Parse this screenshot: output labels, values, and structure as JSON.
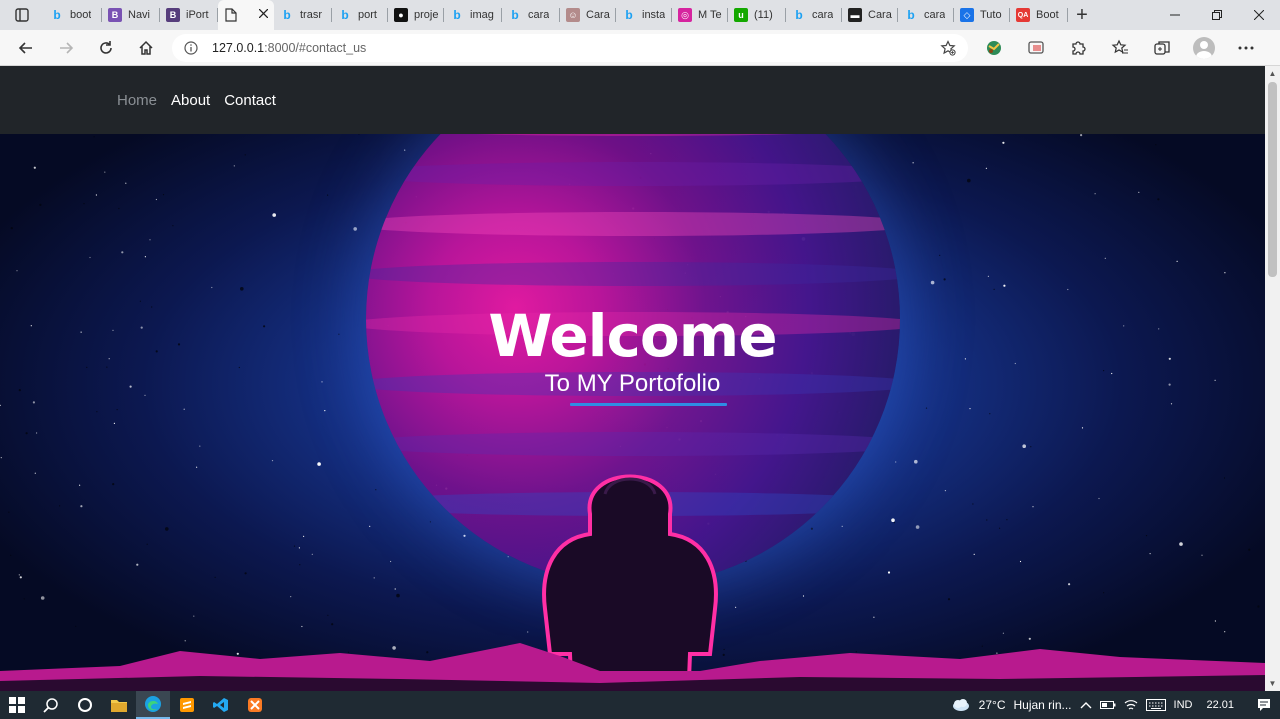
{
  "browser": {
    "tabs": [
      {
        "label": "boot",
        "icon": "bing-icon",
        "color": "#1da1f2"
      },
      {
        "label": "Navi",
        "icon": "bootstrap-icon",
        "color": "#7952b3"
      },
      {
        "label": "iPort",
        "icon": "bootstrap-icon",
        "color": "#563d7c"
      },
      {
        "label": "",
        "icon": "page-icon",
        "color": "#555555",
        "active": true
      },
      {
        "label": "trasr",
        "icon": "bing-icon",
        "color": "#1da1f2"
      },
      {
        "label": "port",
        "icon": "bing-icon",
        "color": "#1da1f2"
      },
      {
        "label": "proje",
        "icon": "github-icon",
        "color": "#111111"
      },
      {
        "label": "imag",
        "icon": "bing-icon",
        "color": "#1da1f2"
      },
      {
        "label": "cara",
        "icon": "bing-icon",
        "color": "#1da1f2"
      },
      {
        "label": "Cara",
        "icon": "avatar-icon",
        "color": "#b38b8b"
      },
      {
        "label": "insta",
        "icon": "bing-icon",
        "color": "#1da1f2"
      },
      {
        "label": "M Te",
        "icon": "instagram-icon",
        "color": "#d6249f"
      },
      {
        "label": "(11)",
        "icon": "upwork-icon",
        "color": "#14a800"
      },
      {
        "label": "cara",
        "icon": "bing-icon",
        "color": "#1da1f2"
      },
      {
        "label": "Cara",
        "icon": "terminal-icon",
        "color": "#222222"
      },
      {
        "label": "cara",
        "icon": "bing-icon",
        "color": "#1da1f2"
      },
      {
        "label": "Tuto",
        "icon": "code-icon",
        "color": "#1a73e8"
      },
      {
        "label": "Boot",
        "icon": "qa-icon",
        "color": "#e53935"
      }
    ],
    "url_host": "127.0.0.1",
    "url_path": ":8000/#contact_us"
  },
  "navbar": {
    "links": [
      "Home",
      "About",
      "Contact"
    ]
  },
  "hero": {
    "title": "Welcome",
    "subtitle": "To MY Portofolio",
    "accent_color": "#2f8de4"
  },
  "taskbar": {
    "weather": "27°C",
    "weather_desc": "Hujan rin...",
    "lang": "IND",
    "time": "22.01"
  }
}
